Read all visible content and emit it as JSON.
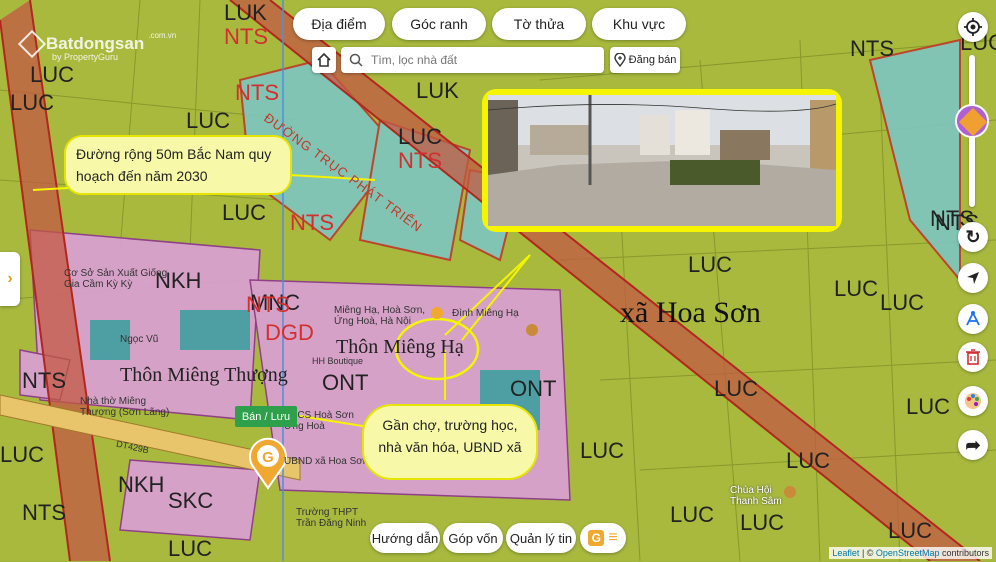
{
  "top_tabs": [
    "Địa điểm",
    "Góc ranh",
    "Tờ thửa",
    "Khu vực"
  ],
  "search": {
    "placeholder": "Tìm, lọc nhà đất"
  },
  "post_button": "Đăng bán",
  "logo": {
    "name": "Batdongsan",
    "sub": "by PropertyGuru",
    "domain": ".com.vn"
  },
  "callouts": {
    "road": "Đường rộng 50m Bắc Nam quy hoạch đến năm 2030",
    "near": "Gần chợ, trường học, nhà văn hóa, UBND xã"
  },
  "save_button": "Bán / Lưu",
  "bottom_buttons": [
    "Hướng dẫn",
    "Góp vốn",
    "Quản lý tin"
  ],
  "map_labels": {
    "commune": "xã Hoa Sơn",
    "village1": "Thôn Miêng Thượng",
    "village2": "Thôn Miêng Hạ",
    "place1": "Miêng Hạ, Hoà Sơn, Ứng Hoà, Hà Nội",
    "place2": "Cơ Sở Sản Xuất Giống Gia Cầm Kỳ Kỳ",
    "place3": "UBND xã Hoa Sơn",
    "place4": "Trường THPT Trần Đăng Ninh",
    "place5": "Chùa Hội Thanh Sâm",
    "road_label": "ĐƯỜNG TRỤC PHÁT TRIỂN",
    "church": "Nhà thờ Miêng Thượng (Sơn Lãng)",
    "school": "THCS Hoà Sơn Ứng Hoà",
    "shop": "HH Boutique",
    "ngoc_vu": "Ngọc Vũ",
    "route": "DT429B",
    "dinh": "Đình Miêng Hạ",
    "zones": [
      "LUK",
      "NTS",
      "LUC",
      "LUC",
      "NTS",
      "LUC",
      "NTS",
      "LUK",
      "LUC",
      "NTS",
      "NTS",
      "NKH",
      "MNC",
      "DGD",
      "NTS",
      "ONT",
      "ONT",
      "NTS",
      "LUC",
      "LUC",
      "LUC",
      "LUC",
      "LUC",
      "LUC",
      "LUC",
      "LUC",
      "NTS",
      "LUC",
      "NKH",
      "SKC",
      "LUC",
      "NTS",
      "LUC",
      "LUC",
      "LUC",
      "LUC",
      "NTS"
    ]
  },
  "attribution": {
    "leaflet": "Leaflet",
    "sep": " | © ",
    "osm": "OpenStreetMap",
    "contrib": " contributors"
  },
  "colors": {
    "luc": "#a3b53a",
    "nts": "#7ec6c0",
    "ont": "#d8a0cf",
    "road": "#c0392b",
    "callout_bg": "#f7f9a8",
    "callout_border": "#e5e500"
  }
}
